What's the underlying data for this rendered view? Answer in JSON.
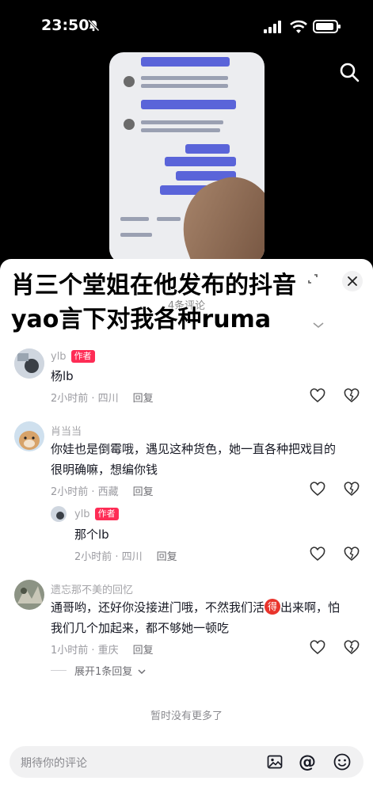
{
  "status_bar": {
    "time": "23:50",
    "icons": [
      "mute-icon",
      "signal-icon",
      "wifi-icon",
      "battery-icon"
    ]
  },
  "video": {
    "search_icon": "search-icon"
  },
  "overlay": {
    "title": "肖三个堂姐在他发布的抖音yao言下对我各种ruma"
  },
  "sheet": {
    "count_label": "4条评论"
  },
  "comments": [
    {
      "name": "ylb",
      "tag": "作者",
      "text": "杨lb",
      "time": "2小时前 · 四川",
      "reply": "回复"
    },
    {
      "name": "肖当当",
      "tag": "",
      "text_line1": "你娃也是倒霉哦，遇见这种货色，她一直各种把戏目的",
      "text_line2": "很明确嘛，想编你钱",
      "time": "2小时前 · 西藏",
      "reply": "回复"
    },
    {
      "name": "ylb",
      "tag": "作者",
      "text": "那个lb",
      "time": "2小时前 · 四川",
      "reply": "回复"
    },
    {
      "name": "遗忘那不美的回忆",
      "tag": "",
      "text_line1_a": "通哥哟，还好你没接进门哦，不然我们活",
      "text_line1_emoji": "得",
      "text_line1_b": "出来啊，怕",
      "text_line2": "我们几个加起来，都不够她一顿吃",
      "time": "1小时前 · 重庆",
      "reply": "回复"
    }
  ],
  "expand_replies": "展开1条回复",
  "no_more": "暂时没有更多了",
  "input": {
    "placeholder": "期待你的评论"
  },
  "colors": {
    "accent": "#fe2c55",
    "text": "#161823",
    "muted": "#9a9aa0"
  }
}
